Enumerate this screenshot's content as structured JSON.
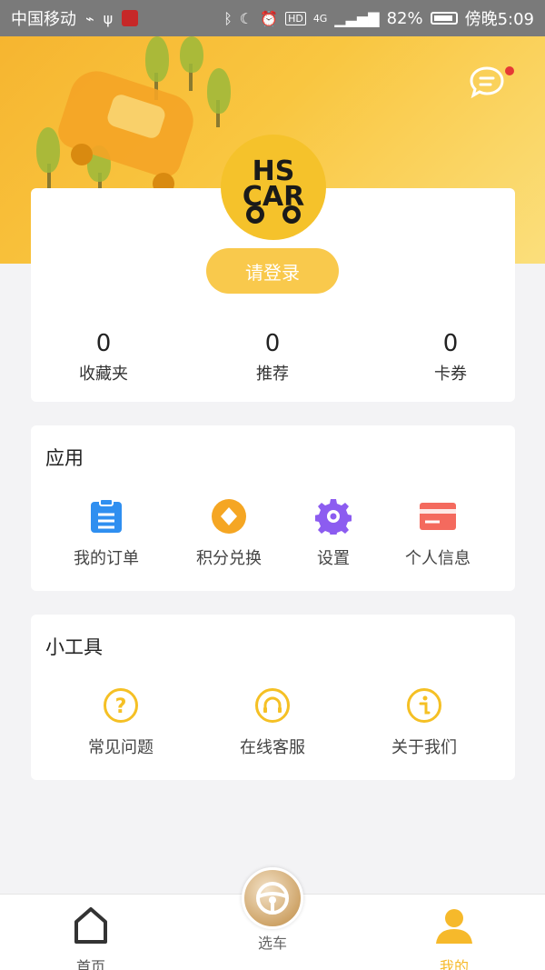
{
  "status_bar": {
    "carrier": "中国移动",
    "battery": "82%",
    "time": "傍晚5:09",
    "network": "4G",
    "hd": "HD"
  },
  "header": {
    "logo_text_top": "HS",
    "logo_text_bottom": "CAR"
  },
  "profile": {
    "login_label": "请登录",
    "stats": [
      {
        "value": "0",
        "label": "收藏夹"
      },
      {
        "value": "0",
        "label": "推荐"
      },
      {
        "value": "0",
        "label": "卡券"
      }
    ]
  },
  "apps": {
    "title": "应用",
    "items": [
      {
        "label": "我的订单",
        "icon": "clipboard-icon",
        "color": "#2f8ff0"
      },
      {
        "label": "积分兑换",
        "icon": "diamond-coin-icon",
        "color": "#f5a623"
      },
      {
        "label": "设置",
        "icon": "gear-icon",
        "color": "#8c5cf0"
      },
      {
        "label": "个人信息",
        "icon": "card-icon",
        "color": "#f46a5e"
      }
    ]
  },
  "tools": {
    "title": "小工具",
    "items": [
      {
        "label": "常见问题",
        "icon": "question-icon"
      },
      {
        "label": "在线客服",
        "icon": "headset-icon"
      },
      {
        "label": "关于我们",
        "icon": "info-icon"
      }
    ]
  },
  "tab_bar": {
    "tabs": [
      {
        "label": "首页",
        "icon": "home-icon"
      },
      {
        "label": "选车",
        "icon": "steering-wheel-icon"
      },
      {
        "label": "我的",
        "icon": "user-icon",
        "active": true
      }
    ],
    "accent": "#f6b92b"
  },
  "colors": {
    "brand_yellow": "#f6b92b",
    "tool_icon": "#f5c024"
  }
}
